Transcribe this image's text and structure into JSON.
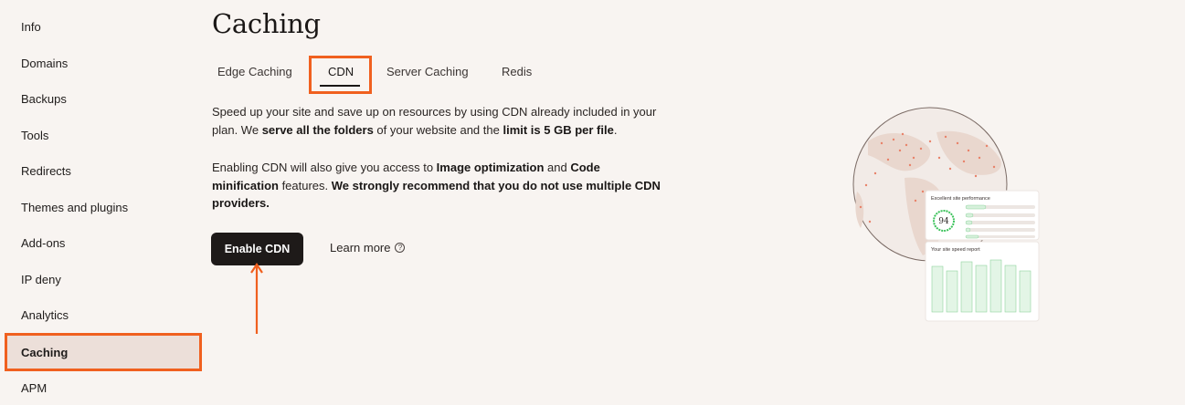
{
  "sidebar": {
    "items": [
      {
        "label": "Info"
      },
      {
        "label": "Domains"
      },
      {
        "label": "Backups"
      },
      {
        "label": "Tools"
      },
      {
        "label": "Redirects"
      },
      {
        "label": "Themes and plugins"
      },
      {
        "label": "Add-ons"
      },
      {
        "label": "IP deny"
      },
      {
        "label": "Analytics"
      },
      {
        "label": "Caching"
      },
      {
        "label": "APM"
      }
    ],
    "active": "Caching"
  },
  "page": {
    "title": "Caching"
  },
  "tabs": [
    {
      "label": "Edge Caching"
    },
    {
      "label": "CDN"
    },
    {
      "label": "Server Caching"
    },
    {
      "label": "Redis"
    }
  ],
  "content": {
    "p1_a": "Speed up your site and save up on resources by using CDN already included in your plan. We ",
    "p1_b": "serve all the folders",
    "p1_c": " of your website and the ",
    "p1_d": "limit is 5 GB per file",
    "p1_e": ".",
    "p2_a": "Enabling CDN will also give you access to ",
    "p2_b": "Image optimization",
    "p2_c": " and ",
    "p2_d": "Code minification",
    "p2_e": " features. ",
    "p2_f": "We strongly recommend that you do not use multiple CDN providers."
  },
  "actions": {
    "enable_label": "Enable CDN",
    "learn_more_label": "Learn more",
    "help_glyph": "?"
  },
  "illustration": {
    "card1_title": "Excellent site performance",
    "score": "94",
    "card2_title": "Your site speed report"
  },
  "colors": {
    "accent": "#f0601f",
    "primary_button": "#1e1a19",
    "background": "#f8f4f1"
  }
}
